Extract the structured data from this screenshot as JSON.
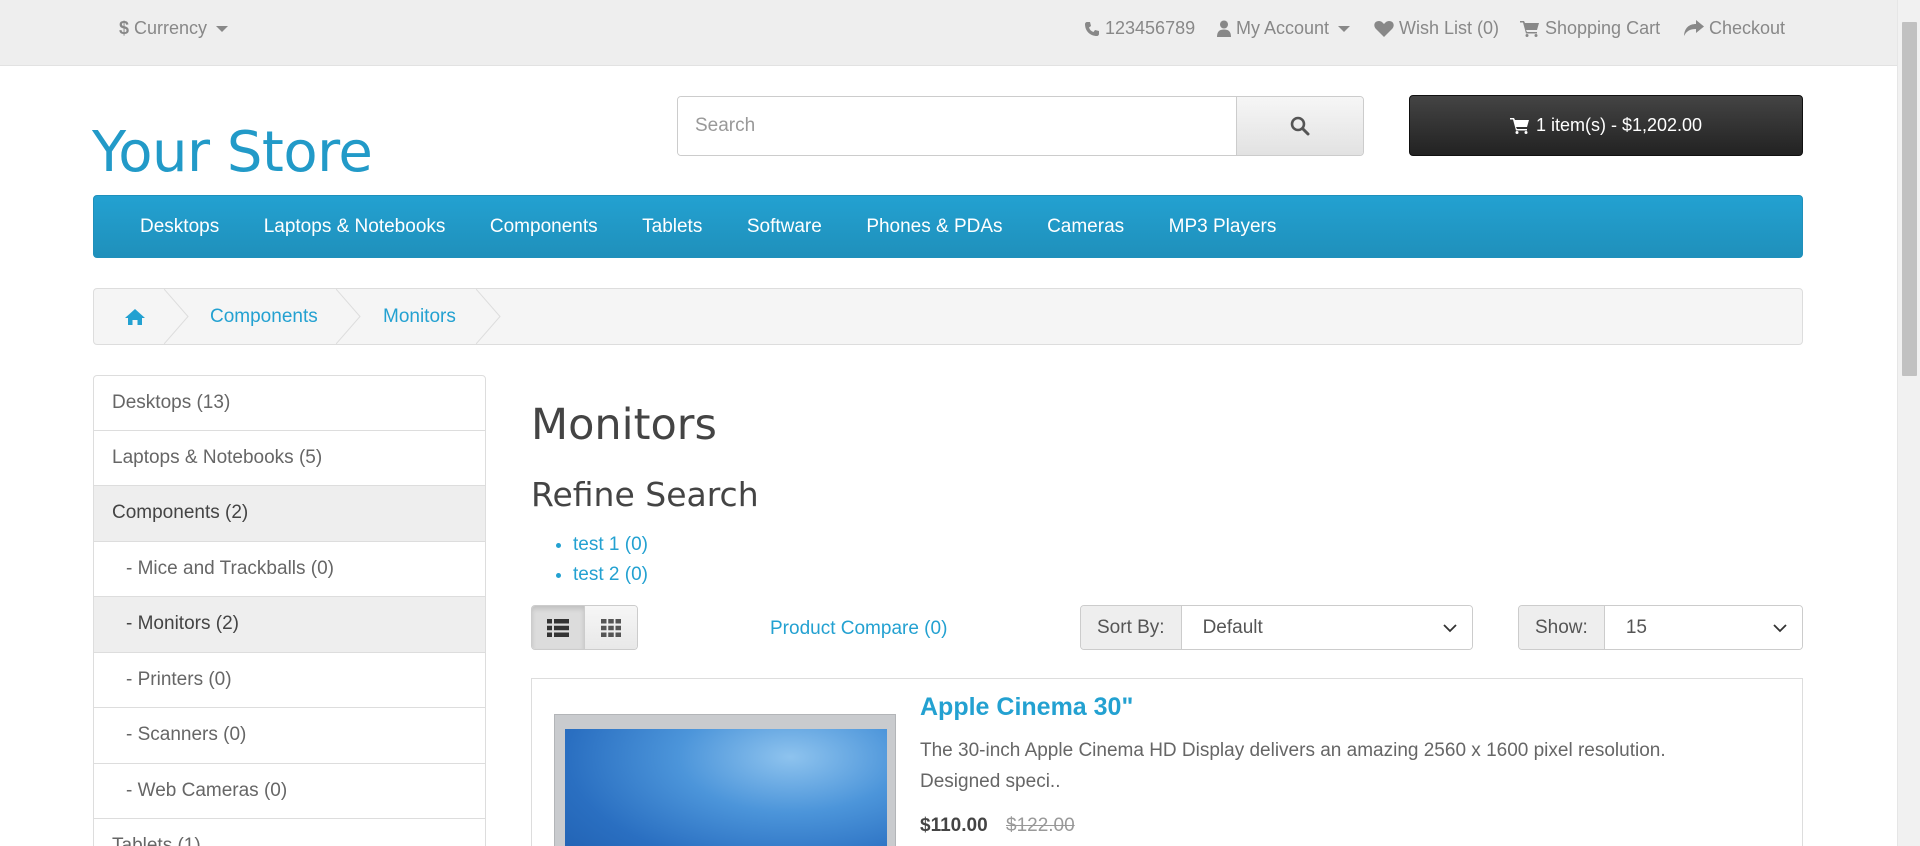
{
  "topbar": {
    "currency_label": "Currency",
    "phone": "123456789",
    "account_label": "My Account",
    "wishlist_label": "Wish List (0)",
    "cart_label": "Shopping Cart",
    "checkout_label": "Checkout"
  },
  "header": {
    "logo": "Your Store",
    "search_placeholder": "Search",
    "cart_summary": "1 item(s) - $1,202.00"
  },
  "menu": {
    "items": [
      "Desktops",
      "Laptops & Notebooks",
      "Components",
      "Tablets",
      "Software",
      "Phones & PDAs",
      "Cameras",
      "MP3 Players"
    ]
  },
  "breadcrumb": {
    "items": [
      "Components",
      "Monitors"
    ]
  },
  "sidebar": {
    "items": [
      {
        "label": "Desktops (13)",
        "active": false
      },
      {
        "label": "Laptops & Notebooks (5)",
        "active": false
      },
      {
        "label": "Components (2)",
        "active": true
      },
      {
        "label": "- Mice and Trackballs (0)",
        "active": false
      },
      {
        "label": "- Monitors (2)",
        "active": true
      },
      {
        "label": "- Printers (0)",
        "active": false
      },
      {
        "label": "- Scanners (0)",
        "active": false
      },
      {
        "label": "- Web Cameras (0)",
        "active": false
      },
      {
        "label": "Tablets (1)",
        "active": false
      }
    ]
  },
  "content": {
    "title": "Monitors",
    "refine_title": "Refine Search",
    "refine_items": [
      "test 1 (0)",
      "test 2 (0)"
    ],
    "compare_label": "Product Compare (0)",
    "sort_label": "Sort By:",
    "sort_value": "Default",
    "show_label": "Show:",
    "show_value": "15"
  },
  "product": {
    "name": "Apple Cinema 30\"",
    "description": "The 30-inch Apple Cinema HD Display delivers an amazing 2560 x 1600 pixel resolution. Designed speci..",
    "price": "$110.00",
    "old_price": "$122.00"
  },
  "colors": {
    "accent": "#229ac8",
    "menu_bg": "#23a1d1",
    "cart_bg": "#333333"
  }
}
